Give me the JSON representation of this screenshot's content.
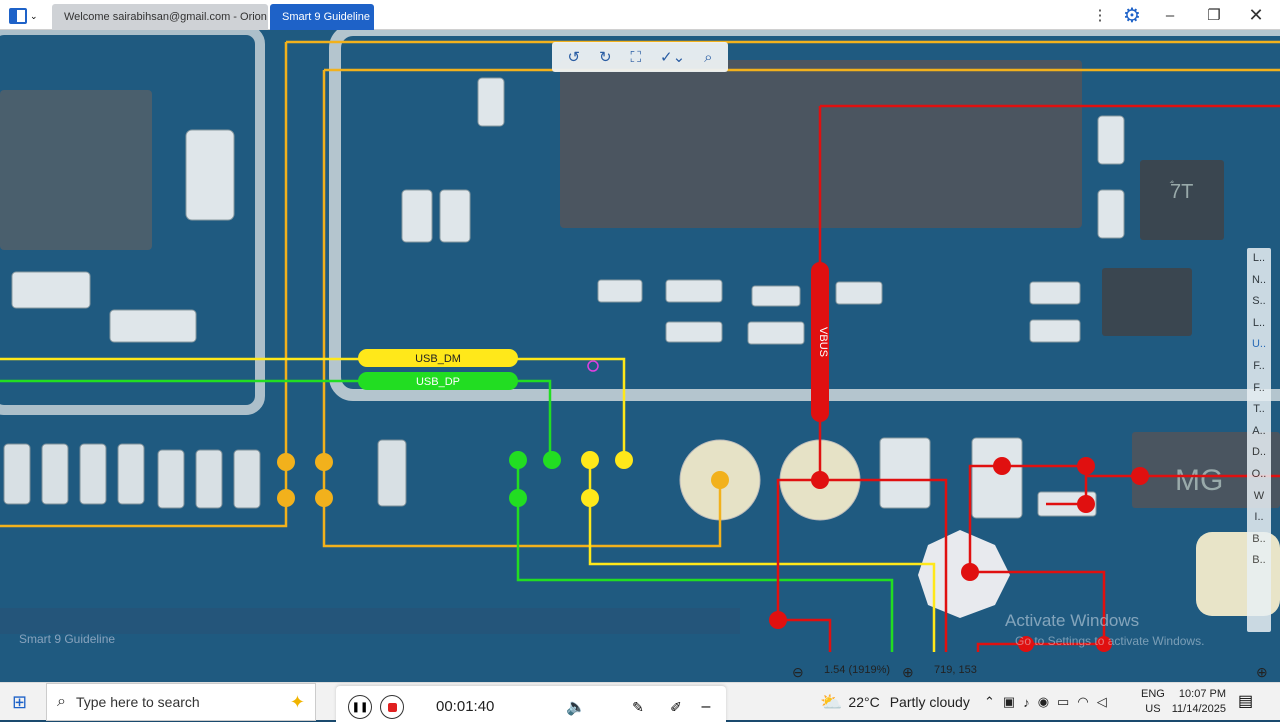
{
  "titlebar": {
    "tabs": [
      {
        "label": "Welcome sairabihsan@gmail.com - Orion"
      },
      {
        "label": "Smart 9 Guideline"
      }
    ]
  },
  "toolbar_icons": [
    "rotate-left-icon",
    "rotate-right-icon",
    "fit-screen-icon",
    "brush-tool-icon",
    "search-icon"
  ],
  "nets": {
    "usb_dm": "USB_DM",
    "usb_dp": "USB_DP",
    "vbus": "VBUS"
  },
  "chip_marks": {
    "ic1": "ۘ7T",
    "ic2": "MG"
  },
  "side_index": [
    "L..",
    "N..",
    "S..",
    "L..",
    "U..",
    "F..",
    "F..",
    "T..",
    "A..",
    "D..",
    "O..",
    "W",
    "I..",
    "B..",
    "B.."
  ],
  "status": {
    "zoom": "1.54 (1919%)",
    "coords": "719, 153"
  },
  "watermark": "Smart 9 Guideline",
  "activate": {
    "title": "Activate Windows",
    "sub": "Go to Settings to activate Windows."
  },
  "taskbar": {
    "search_placeholder": "Type here to search",
    "recording_time": "00:01:40",
    "weather_temp": "22°C",
    "weather_desc": "Partly cloudy",
    "lang_top": "ENG",
    "lang_bottom": "US",
    "time": "10:07 PM",
    "date": "11/14/2025"
  },
  "colors": {
    "accent": "#1e62c8",
    "dm": "#ffe81a",
    "dp": "#22dd22",
    "vbus": "#e01010",
    "trace_orange": "#f2b11c"
  }
}
